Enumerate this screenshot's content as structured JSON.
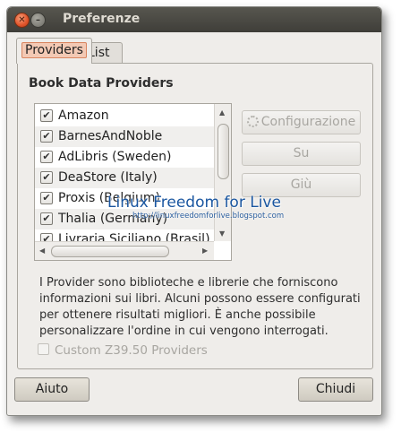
{
  "window": {
    "title": "Preferenze"
  },
  "titlebar": {
    "close_icon": "✕",
    "minimize_icon": "–"
  },
  "tabs": [
    {
      "label": "Providers",
      "active": true
    },
    {
      "label": "List View",
      "active": false
    }
  ],
  "section": {
    "title": "Book Data Providers"
  },
  "providers": [
    {
      "label": "Amazon",
      "checked": true
    },
    {
      "label": "BarnesAndNoble",
      "checked": true
    },
    {
      "label": "AdLibris (Sweden)",
      "checked": true
    },
    {
      "label": "DeaStore (Italy)",
      "checked": true
    },
    {
      "label": "Proxis (Belgium)",
      "checked": true
    },
    {
      "label": "Thalia (Germany)",
      "checked": true
    },
    {
      "label": "Livraria Siciliano (Brasil)",
      "checked": true
    }
  ],
  "check_glyph": "✔",
  "side_buttons": {
    "configure": "Configurazione",
    "up": "Su",
    "down": "Giù"
  },
  "description": "I Provider sono biblioteche e librerie che forniscono informazioni sui libri. Alcuni possono essere configurati per ottenere risultati migliori. È anche possibile personalizzare l'ordine in cui vengono interrogati.",
  "custom_providers": {
    "label": "Custom Z39.50 Providers",
    "checked": false
  },
  "footer": {
    "help": "Aiuto",
    "close": "Chiudi"
  },
  "watermark": {
    "title": "Linux Freedom for Live",
    "url": "http://linuxfreedomforlive.blogspot.com"
  },
  "scroll_arrows": {
    "up": "▲",
    "down": "▼",
    "left": "◀",
    "right": "▶"
  }
}
